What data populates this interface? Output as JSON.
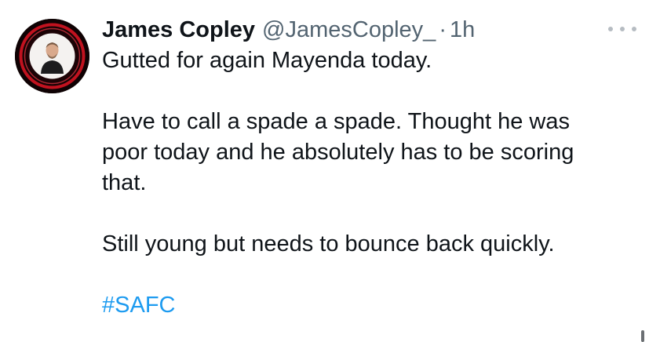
{
  "tweet": {
    "author_name": "James Copley",
    "handle": "@JamesCopley_",
    "separator": "·",
    "time": "1h",
    "lines_p1": [
      "Gutted for again Mayenda today."
    ],
    "lines_p2": [
      "Have to call a spade a spade. Thought he was",
      "poor today and he absolutely has to be scoring",
      "that."
    ],
    "lines_p3": [
      "Still young but needs to bounce back quickly."
    ],
    "hashtag": "#SAFC"
  },
  "icons": {
    "more": "more-options-icon",
    "avatar": "profile-avatar"
  },
  "colors": {
    "text": "#0f1419",
    "secondary": "#536471",
    "link": "#1d9bf0"
  }
}
